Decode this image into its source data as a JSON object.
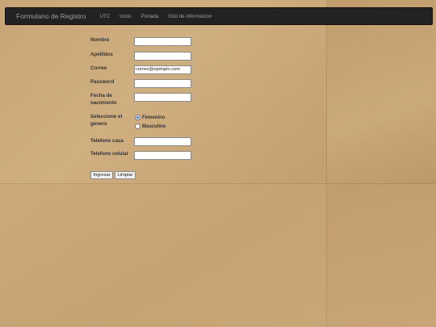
{
  "navbar": {
    "brand": "Formulario de Registro",
    "links": [
      "UTC",
      "Inicio",
      "Portada",
      "Grid de informacion"
    ]
  },
  "form": {
    "nombre_label": "Nombre",
    "apellidos_label": "Apellidos",
    "correo_label": "Correo",
    "correo_value": "correo@ejemplo.com",
    "password_label": "Password",
    "fecha_label": "Fecha de nacimiento",
    "genero_label": "Seleccione el genero",
    "genero_options": [
      "Femenino",
      "Masculino"
    ],
    "genero_selected": "Femenino",
    "tel_casa_label": "Telefono casa",
    "tel_celular_label": "Telefono celular",
    "ingresar_label": "Ingresar",
    "limpiar_label": "Limpiar"
  }
}
